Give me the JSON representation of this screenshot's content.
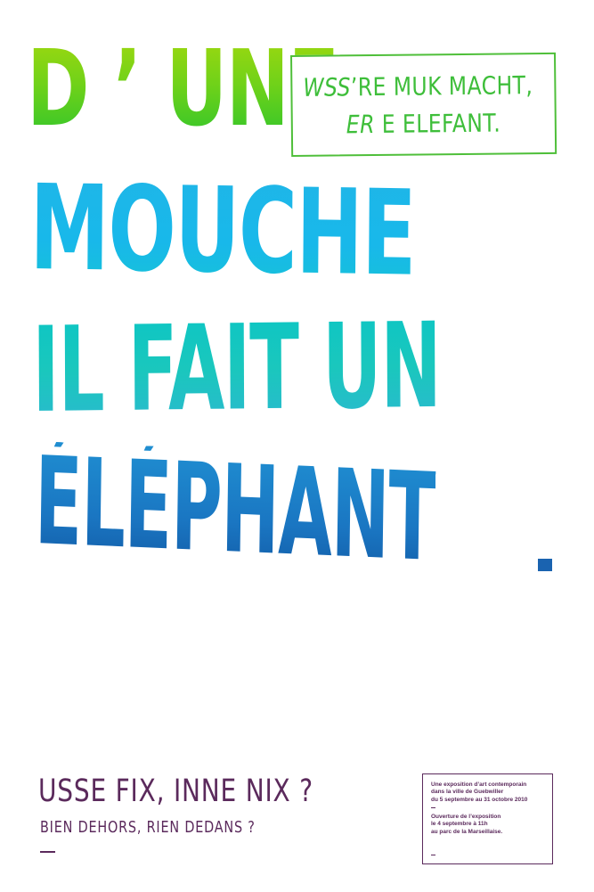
{
  "headline": {
    "line1": "D ’ UNE",
    "line2": "MOUCHE",
    "line3": "IL FAIT UN",
    "line4": "ÉLÉPHANT",
    "period": "."
  },
  "speech_box": {
    "line1_italic": "WSS",
    "line1_rest": "’RE MUK MACHT,",
    "line2_italic": "ER",
    "line2_rest": " E ELEFANT."
  },
  "footer": {
    "title": "USSE FIX, INNE NIX ?",
    "subtitle": "BIEN DEHORS, RIEN DEDANS ?",
    "info_block_1": "Une exposition d’art contemporain\ndans la ville de Guebwiller\ndu 5 septembre au 31 octobre 2010",
    "info_block_2": "Ouverture de l’exposition\nle 4 septembre à 11h\nau parc de la Marseillaise."
  },
  "colors": {
    "green": "#4fbf3a",
    "cyan": "#1fb6e8",
    "teal": "#0dc6c4",
    "blue": "#1a76c2",
    "plum": "#5b2a5c"
  }
}
